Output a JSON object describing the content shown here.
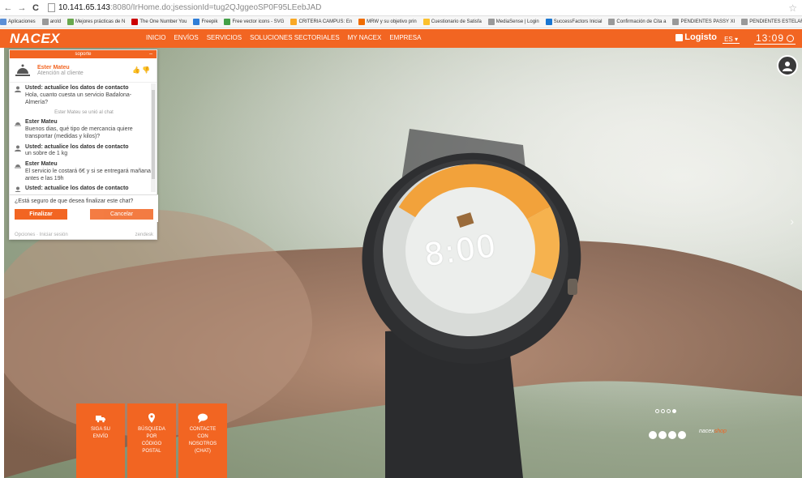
{
  "browser": {
    "url_host": "10.141.65.143",
    "url_path": ":8080/IrHome.do;jsessionId=tug2QJggeoSP0F95LEebJAD",
    "bookmarks": [
      {
        "label": "Aplicaciones",
        "color": "#5b8fd6"
      },
      {
        "label": "arold",
        "color": "#999999"
      },
      {
        "label": "Mejores prácticas de N",
        "color": "#6aa84f"
      },
      {
        "label": "The One Number You",
        "color": "#cc0000"
      },
      {
        "label": "Freepik",
        "color": "#2f7ed8"
      },
      {
        "label": "Free vector icons - SVG",
        "color": "#43a047"
      },
      {
        "label": "CRITERIA CAMPUS: En",
        "color": "#f9a825"
      },
      {
        "label": "MRW y su objetivo prin",
        "color": "#ef6c00"
      },
      {
        "label": "Cuestionario de Satisfa",
        "color": "#fbc02d"
      },
      {
        "label": "MediaSense | Login",
        "color": "#999999"
      },
      {
        "label": "SuccessFactors Inicial",
        "color": "#1976d2"
      },
      {
        "label": "Confirmación de Cita a",
        "color": "#999999"
      },
      {
        "label": "PENDIENTES PASSY XI",
        "color": "#999999"
      },
      {
        "label": "PENDIENTES ESTELAR",
        "color": "#999999"
      }
    ]
  },
  "header": {
    "logo": "NACEX",
    "menu": [
      "INICIO",
      "ENVÍOS",
      "SERVICIOS",
      "SOLUCIONES SECTORIALES",
      "MY NACEX",
      "EMPRESA"
    ],
    "logisto": "Logisto",
    "lang": "ES ▾",
    "clock": "13:09"
  },
  "hero": {
    "watch_time": "8:00",
    "carousel_pages": 4,
    "carousel_active": 4
  },
  "shop": {
    "brand_a": "nacex",
    "brand_b": "shop"
  },
  "tiles": [
    {
      "label": "SIGA SU\nENVÍO",
      "icon": "truck-icon"
    },
    {
      "label": "BÚSQUEDA\nPOR\nCÓDIGO\nPOSTAL",
      "icon": "location-pin-icon"
    },
    {
      "label": "CONTACTE\nCON\nNOSOTROS\n(CHAT)",
      "icon": "chat-bubble-icon"
    }
  ],
  "chat": {
    "title": "soporte",
    "minimize": "–",
    "agent_name": "Ester Mateu",
    "agent_role": "Atención al cliente",
    "rating": "👍👎",
    "messages": [
      {
        "who": "Usted: actualice los datos de contacto",
        "text": "Hola, cuanto cuesta un servicio Badalona-Almería?",
        "kind": "user"
      },
      {
        "note": "Ester Mateu se unió al chat"
      },
      {
        "who": "Ester Mateu",
        "text": "Buenos dias, qué tipo de mercancia quiere transportar (medidas y kilos)?",
        "kind": "agent"
      },
      {
        "who": "Usted: actualice los datos de contacto",
        "text": "un sobre de 1 kg",
        "kind": "user"
      },
      {
        "who": "Ester Mateu",
        "text": "El servicio le costará 6€ y si se entregará mañana antes e las 19h",
        "kind": "agent"
      },
      {
        "who": "Usted: actualice los datos de contacto",
        "text": "",
        "kind": "user"
      }
    ],
    "confirm_question": "¿Está seguro de que desea finalizar este chat?",
    "finish_label": "Finalizar",
    "cancel_label": "Cancelar",
    "footer_left": "Opciones · Iniciar sesión",
    "footer_right": "zendesk"
  },
  "colors": {
    "brand": "#f26522"
  }
}
